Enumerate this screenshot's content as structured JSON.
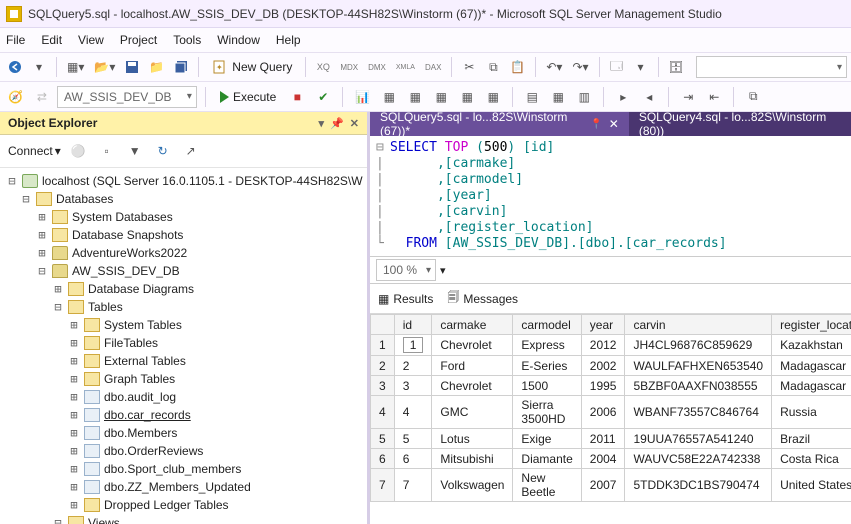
{
  "window": {
    "title": "SQLQuery5.sql - localhost.AW_SSIS_DEV_DB (DESKTOP-44SH82S\\Winstorm (67))* - Microsoft SQL Server Management Studio"
  },
  "menu": {
    "file": "File",
    "edit": "Edit",
    "view": "View",
    "project": "Project",
    "tools": "Tools",
    "window": "Window",
    "help": "Help"
  },
  "toolbar": {
    "new_query": "New Query"
  },
  "toolbar2": {
    "db_combo": "AW_SSIS_DEV_DB",
    "execute": "Execute"
  },
  "objexp": {
    "title": "Object Explorer",
    "connect": "Connect",
    "server": "localhost (SQL Server 16.0.1105.1 - DESKTOP-44SH82S\\W",
    "databases": "Databases",
    "sysdb": "System Databases",
    "snapshots": "Database Snapshots",
    "adv": "AdventureWorks2022",
    "devdb": "AW_SSIS_DEV_DB",
    "diag": "Database Diagrams",
    "tables": "Tables",
    "systables": "System Tables",
    "filetables": "FileTables",
    "exttables": "External Tables",
    "graphtables": "Graph Tables",
    "t_audit": "dbo.audit_log",
    "t_car": "dbo.car_records",
    "t_members": "dbo.Members",
    "t_orders": "dbo.OrderReviews",
    "t_sport": "dbo.Sport_club_members",
    "t_zz": "dbo.ZZ_Members_Updated",
    "dropped": "Dropped Ledger Tables",
    "views": "Views"
  },
  "tabs": {
    "t1": "SQLQuery5.sql - lo...82S\\Winstorm (67))*",
    "t2": "SQLQuery4.sql - lo...82S\\Winstorm (80))"
  },
  "sql": {
    "l1a": "SELECT",
    "l1b": " TOP ",
    "l1c": "(",
    "l1d": "500",
    "l1e": ") ",
    "l1f": "[id]",
    "l2": "      ,[carmake]",
    "l3": "      ,[carmodel]",
    "l4": "      ,[year]",
    "l5": "      ,[carvin]",
    "l6": "      ,[register_location]",
    "l7a": "  FROM ",
    "l7b": "[AW_SSIS_DEV_DB].[dbo].[car_records]"
  },
  "zoom": "100 %",
  "res": {
    "results": "Results",
    "messages": "Messages"
  },
  "grid": {
    "cols": {
      "id": "id",
      "carmake": "carmake",
      "carmodel": "carmodel",
      "year": "year",
      "carvin": "carvin",
      "reg": "register_location"
    },
    "rows": [
      {
        "n": "1",
        "id": "1",
        "carmake": "Chevrolet",
        "carmodel": "Express",
        "year": "2012",
        "carvin": "JH4CL96876C859629",
        "reg": "Kazakhstan"
      },
      {
        "n": "2",
        "id": "2",
        "carmake": "Ford",
        "carmodel": "E-Series",
        "year": "2002",
        "carvin": "WAULFAFHXEN653540",
        "reg": "Madagascar"
      },
      {
        "n": "3",
        "id": "3",
        "carmake": "Chevrolet",
        "carmodel": "1500",
        "year": "1995",
        "carvin": "5BZBF0AAXFN038555",
        "reg": "Madagascar"
      },
      {
        "n": "4",
        "id": "4",
        "carmake": "GMC",
        "carmodel": "Sierra 3500HD",
        "year": "2006",
        "carvin": "WBANF73557C846764",
        "reg": "Russia"
      },
      {
        "n": "5",
        "id": "5",
        "carmake": "Lotus",
        "carmodel": "Exige",
        "year": "2011",
        "carvin": "19UUA76557A541240",
        "reg": "Brazil"
      },
      {
        "n": "6",
        "id": "6",
        "carmake": "Mitsubishi",
        "carmodel": "Diamante",
        "year": "2004",
        "carvin": "WAUVC58E22A742338",
        "reg": "Costa Rica"
      },
      {
        "n": "7",
        "id": "7",
        "carmake": "Volkswagen",
        "carmodel": "New Beetle",
        "year": "2007",
        "carvin": "5TDDK3DC1BS790474",
        "reg": "United States"
      }
    ]
  }
}
